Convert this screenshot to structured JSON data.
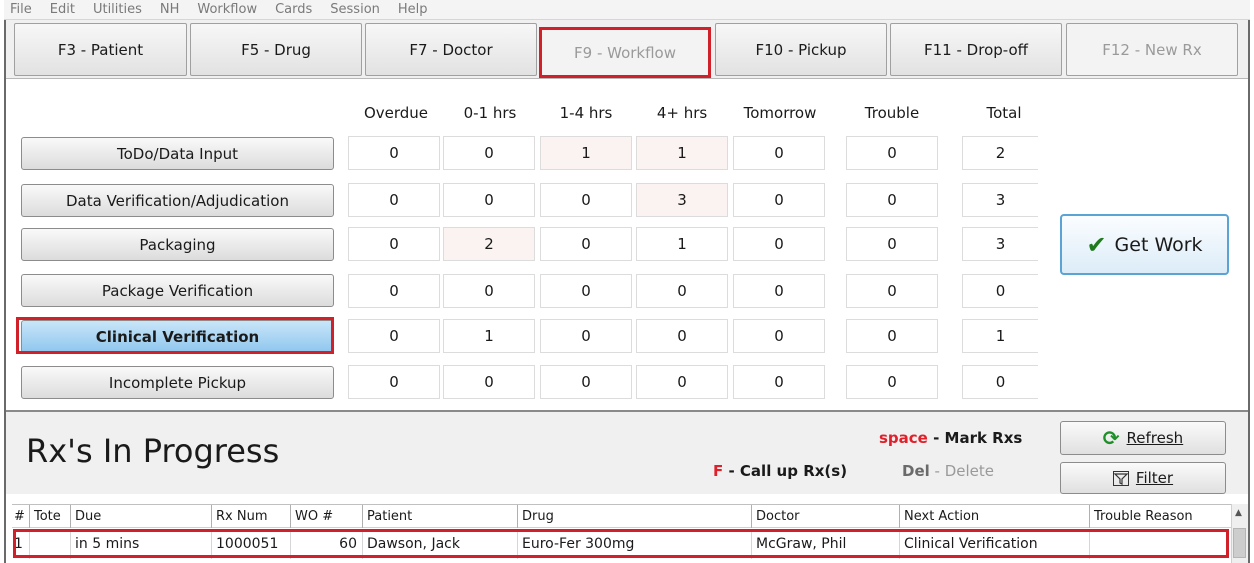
{
  "menu": [
    "File",
    "Edit",
    "Utilities",
    "NH",
    "Workflow",
    "Cards",
    "Session",
    "Help"
  ],
  "fkeys": [
    "F3 - Patient",
    "F5 - Drug",
    "F7 - Doctor",
    "F9 - Workflow",
    "F10 - Pickup",
    "F11 - Drop-off",
    "F12 - New Rx"
  ],
  "columns": [
    "Overdue",
    "0-1 hrs",
    "1-4 hrs",
    "4+ hrs",
    "Tomorrow",
    "Trouble",
    "Total"
  ],
  "queues": [
    {
      "label": "ToDo/Data Input",
      "values": [
        "0",
        "0",
        "1",
        "1",
        "0",
        "0",
        "2"
      ]
    },
    {
      "label": "Data Verification/Adjudication",
      "values": [
        "0",
        "0",
        "0",
        "3",
        "0",
        "0",
        "3"
      ]
    },
    {
      "label": "Packaging",
      "values": [
        "0",
        "2",
        "0",
        "1",
        "0",
        "0",
        "3"
      ]
    },
    {
      "label": "Package Verification",
      "values": [
        "0",
        "0",
        "0",
        "0",
        "0",
        "0",
        "0"
      ]
    },
    {
      "label": "Clinical Verification",
      "values": [
        "0",
        "1",
        "0",
        "0",
        "0",
        "0",
        "1"
      ]
    },
    {
      "label": "Incomplete Pickup",
      "values": [
        "0",
        "0",
        "0",
        "0",
        "0",
        "0",
        "0"
      ]
    }
  ],
  "get_work_label": "Get Work",
  "progress": {
    "title": "Rx's In Progress",
    "space_key": "space",
    "space_sep": " - ",
    "space_action": "Mark Rxs",
    "f_key": "F",
    "f_sep": " - ",
    "f_action": "Call up Rx(s)",
    "del_key": "Del",
    "del_sep": " - ",
    "del_action": "Delete",
    "refresh_label": "Refresh",
    "filter_label": "Filter"
  },
  "table": {
    "headers": [
      "#",
      "Tote",
      "Due",
      "Rx Num",
      "WO #",
      "Patient",
      "Drug",
      "Doctor",
      "Next Action",
      "Trouble Reason"
    ],
    "rows": [
      [
        "1",
        "",
        "in 5 mins",
        "1000051",
        "60",
        "Dawson, Jack",
        "Euro-Fer 300mg",
        "McGraw, Phil",
        "Clinical Verification",
        ""
      ]
    ]
  },
  "colors": {
    "highlight": "#d0202a",
    "accent": "#5aa3d4",
    "active_button": "#8fc7ee"
  }
}
